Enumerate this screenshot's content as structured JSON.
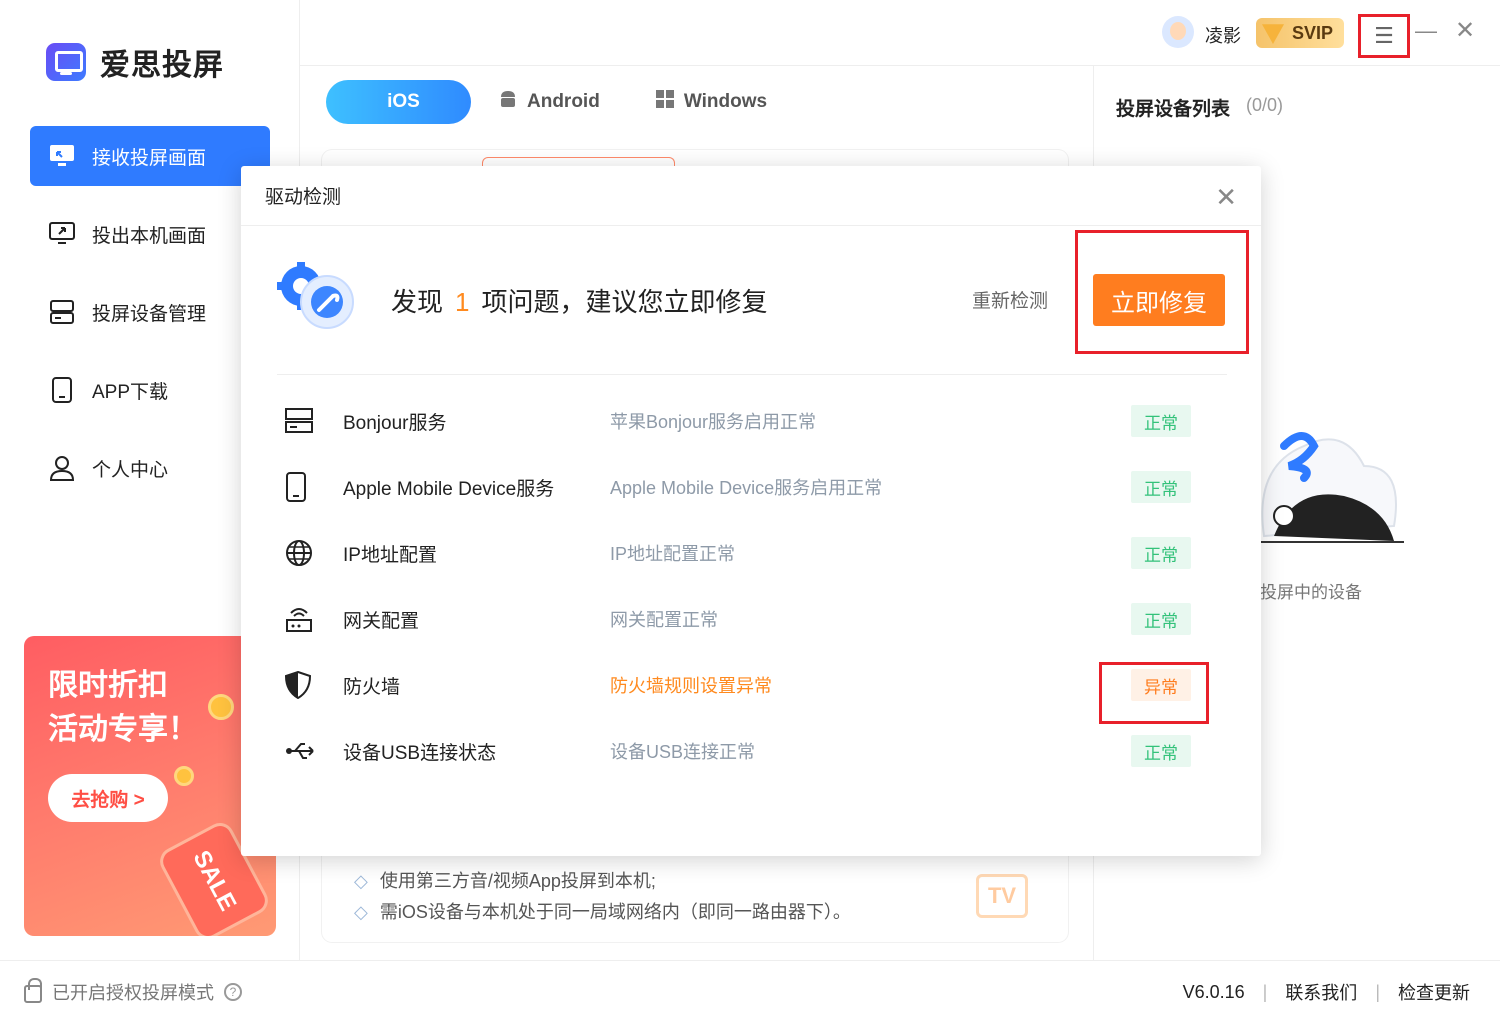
{
  "app": {
    "name": "爱思投屏"
  },
  "sidebar": {
    "items": [
      {
        "label": "接收投屏画面",
        "icon": "receive-screen-icon",
        "active": true
      },
      {
        "label": "投出本机画面",
        "icon": "cast-screen-icon",
        "active": false
      },
      {
        "label": "投屏设备管理",
        "icon": "device-manage-icon",
        "active": false
      },
      {
        "label": "APP下载",
        "icon": "phone-icon",
        "active": false
      },
      {
        "label": "个人中心",
        "icon": "user-icon",
        "active": false
      }
    ],
    "promo": {
      "title_line1": "限时折扣",
      "title_line2": "活动专享！",
      "button": "去抢购 >",
      "tag": "SALE"
    }
  },
  "header": {
    "user_name": "凌影",
    "vip_label": "SVIP"
  },
  "tabs": [
    {
      "label": "iOS",
      "active": true
    },
    {
      "label": "Android",
      "active": false
    },
    {
      "label": "Windows",
      "active": false
    }
  ],
  "right_panel": {
    "title": "投屏设备列表",
    "count": "(0/0)",
    "empty_text": "投屏中的设备"
  },
  "tips": [
    "使用第三方音/视频App投屏到本机;",
    "需iOS设备与本机处于同一局域网络内（即同一路由器下）。"
  ],
  "tv_icon_text": "TV",
  "footer": {
    "auth_text": "已开启授权投屏模式",
    "version": "V6.0.16",
    "contact": "联系我们",
    "update": "检查更新"
  },
  "dialog": {
    "title": "驱动检测",
    "summary_prefix": "发现",
    "issue_count": "1",
    "summary_suffix": "项问题，建议您立即修复",
    "recheck": "重新检测",
    "fix_button": "立即修复",
    "checks": [
      {
        "name": "Bonjour服务",
        "desc": "苹果Bonjour服务启用正常",
        "status": "正常",
        "ok": true,
        "icon": "server-icon"
      },
      {
        "name": "Apple Mobile Device服务",
        "desc": "Apple Mobile Device服务启用正常",
        "status": "正常",
        "ok": true,
        "icon": "mobile-icon"
      },
      {
        "name": "IP地址配置",
        "desc": "IP地址配置正常",
        "status": "正常",
        "ok": true,
        "icon": "globe-icon"
      },
      {
        "name": "网关配置",
        "desc": "网关配置正常",
        "status": "正常",
        "ok": true,
        "icon": "router-icon"
      },
      {
        "name": "防火墙",
        "desc": "防火墙规则设置异常",
        "status": "异常",
        "ok": false,
        "icon": "shield-icon"
      },
      {
        "name": "设备USB连接状态",
        "desc": "设备USB连接正常",
        "status": "正常",
        "ok": true,
        "icon": "usb-icon"
      }
    ]
  },
  "colors": {
    "primary": "#2f7bff",
    "fix": "#ff7d1f",
    "ok": "#33c27a",
    "warn": "#ff7d1f",
    "highlight": "#e8202a"
  }
}
